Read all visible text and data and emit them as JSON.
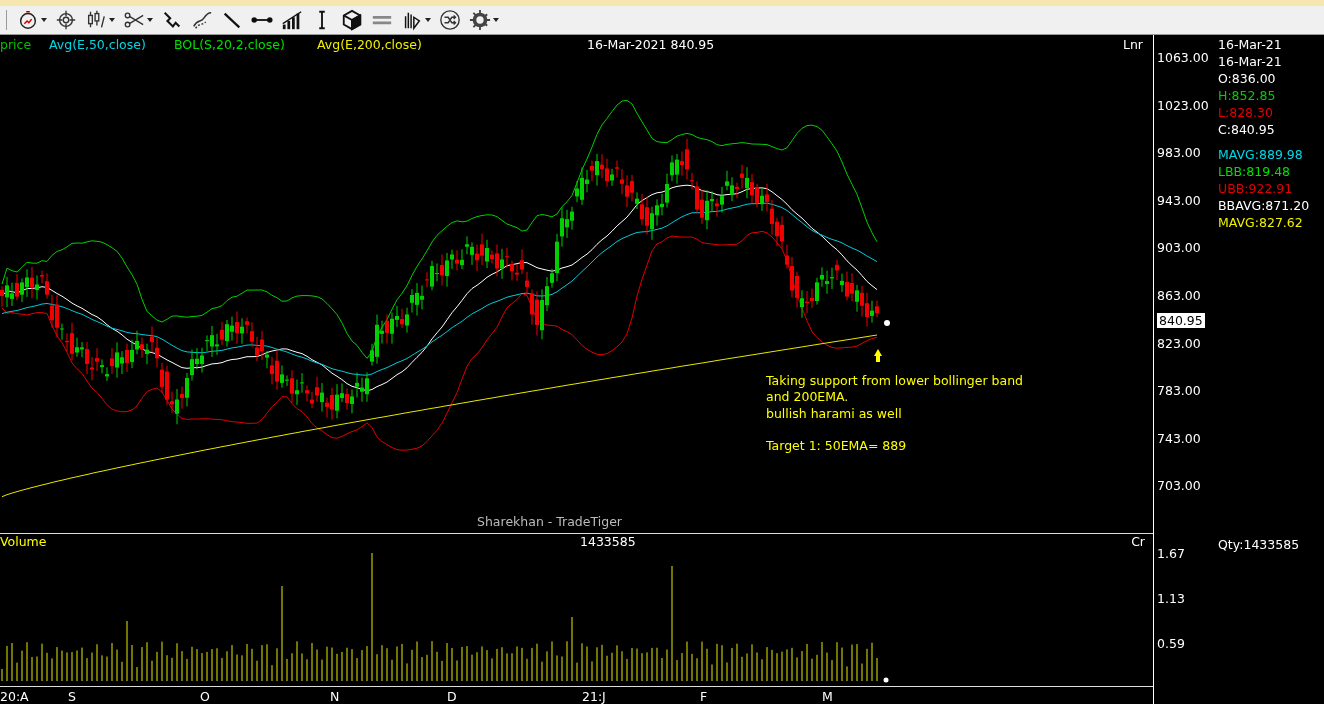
{
  "legend": [
    {
      "label": "price",
      "color": "#00c000"
    },
    {
      "label": "Avg(E,50,close)",
      "color": "#00d8e8"
    },
    {
      "label": "BOL(S,20,2,close)",
      "color": "#00e000"
    },
    {
      "label": "Avg(E,200,close)",
      "color": "#f0f000"
    }
  ],
  "header": "16-Mar-2021 840.95",
  "scale_mode": "Lnr",
  "price_ticks": [
    "1063.00",
    "1023.00",
    "983.00",
    "943.00",
    "903.00",
    "863.00",
    "823.00",
    "783.00",
    "743.00",
    "703.00"
  ],
  "last_price": "840.95",
  "info": [
    {
      "text": "16-Mar-21",
      "color": "#ffffff"
    },
    {
      "text": "16-Mar-21",
      "color": "#ffffff"
    },
    {
      "text": "O:836.00",
      "color": "#ffffff"
    },
    {
      "text": "H:852.85",
      "color": "#00d000"
    },
    {
      "text": "L:828.30",
      "color": "#e00000"
    },
    {
      "text": "C:840.95",
      "color": "#ffffff"
    }
  ],
  "indicators": [
    {
      "text": "MAVG:889.98",
      "color": "#00d8e8"
    },
    {
      "text": "LBB:819.48",
      "color": "#00e000"
    },
    {
      "text": "UBB:922.91",
      "color": "#e00000"
    },
    {
      "text": "BBAVG:871.20",
      "color": "#ffffff"
    },
    {
      "text": "MAVG:827.62",
      "color": "#f0f000"
    }
  ],
  "note": "Taking support from lower bollinger band\nand 200EMA.\nbullish harami as well\n\nTarget 1: 50EMA= 889",
  "chart_label": "Sharekhan - TradeTiger",
  "volume": {
    "title": "Volume",
    "value": "1433585",
    "unit": "Cr",
    "ticks": [
      "1.67",
      "1.13",
      "0.59"
    ],
    "qty": "Qty:1433585"
  },
  "x_labels": [
    "20:A",
    "S",
    "O",
    "N",
    "D",
    "21:J",
    "F",
    "M"
  ]
}
